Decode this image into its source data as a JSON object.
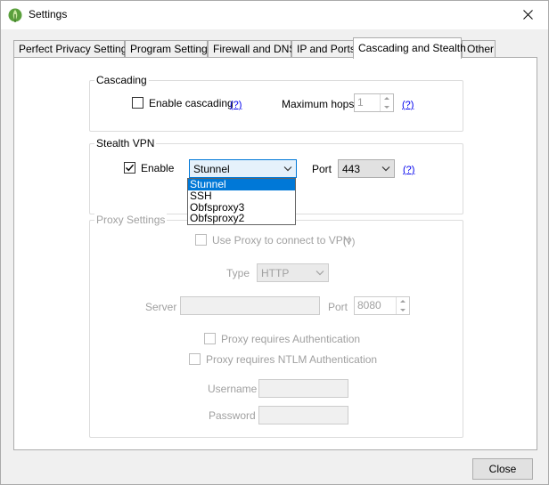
{
  "window": {
    "title": "Settings"
  },
  "tabs": [
    {
      "label": "Perfect Privacy Settings"
    },
    {
      "label": "Program Settings"
    },
    {
      "label": "Firewall and DNS"
    },
    {
      "label": "IP and Ports"
    },
    {
      "label": "Cascading and Stealth",
      "active": true
    },
    {
      "label": "Other"
    }
  ],
  "cascading": {
    "title": "Cascading",
    "enable_label": "Enable cascading",
    "enable_checked": false,
    "help1": "(?)",
    "max_hops_label": "Maximum hops",
    "max_hops_value": "1",
    "help2": "(?)"
  },
  "stealth": {
    "title": "Stealth VPN",
    "enable_label": "Enable",
    "enable_checked": true,
    "protocol_selected": "Stunnel",
    "protocol_options": [
      "Stunnel",
      "SSH",
      "Obfsproxy3",
      "Obfsproxy2"
    ],
    "port_label": "Port",
    "port_value": "443",
    "help": "(?)"
  },
  "proxy": {
    "title": "Proxy Settings",
    "use_proxy_label": "Use Proxy to connect to VPN",
    "use_proxy_help": "(?)",
    "type_label": "Type",
    "type_value": "HTTP",
    "server_label": "Server",
    "server_value": "",
    "port_label": "Port",
    "port_value": "8080",
    "auth_label": "Proxy requires Authentication",
    "ntlm_label": "Proxy requires NTLM Authentication",
    "username_label": "Username",
    "password_label": "Password"
  },
  "footer": {
    "close_label": "Close"
  },
  "colors": {
    "accent": "#0078d7",
    "link": "#0000ee",
    "disabled_text": "#a0a0a0"
  }
}
